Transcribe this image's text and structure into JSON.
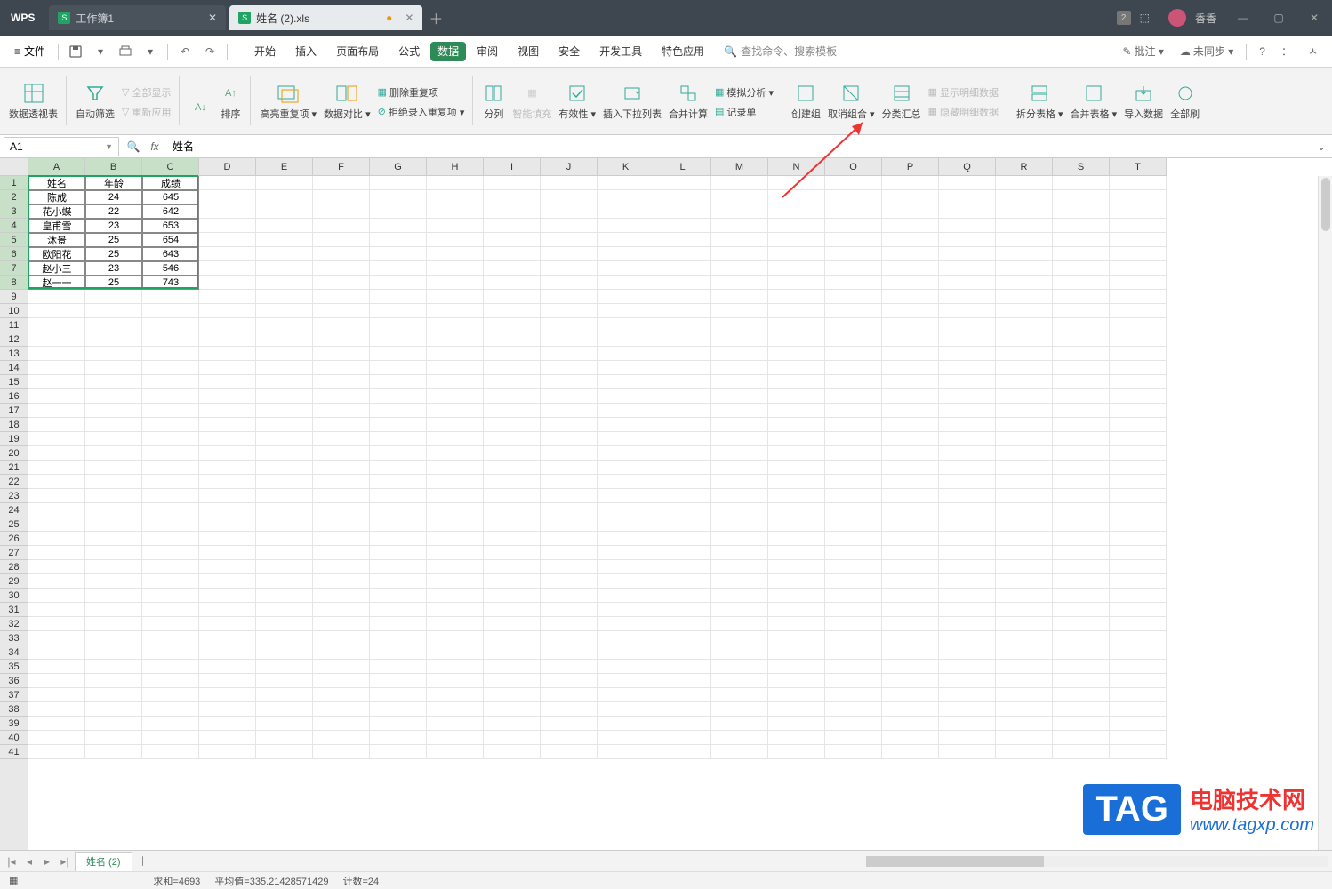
{
  "titlebar": {
    "logo": "WPS",
    "tabs": [
      {
        "label": "工作簿1",
        "active": false
      },
      {
        "label": "姓名 (2).xls",
        "active": true
      }
    ],
    "user": "香香",
    "badge": "2"
  },
  "menubar": {
    "file": "文件",
    "tabs": [
      "开始",
      "插入",
      "页面布局",
      "公式",
      "数据",
      "审阅",
      "视图",
      "安全",
      "开发工具",
      "特色应用"
    ],
    "active_index": 4,
    "search_placeholder": "查找命令、搜索模板",
    "right": {
      "annotate": "批注 ▾",
      "sync": "未同步 ▾"
    }
  },
  "ribbon": {
    "pivot": "数据透视表",
    "autofilter": "自动筛选",
    "showall": "全部显示",
    "reapply": "重新应用",
    "sort": "排序",
    "highlight": "高亮重复项 ▾",
    "compare": "数据对比 ▾",
    "deldup": "删除重复项",
    "reject": "拒绝录入重复项 ▾",
    "split": "分列",
    "flashfill": "智能填充",
    "validation": "有效性 ▾",
    "dropdown": "插入下拉列表",
    "consolidate": "合并计算",
    "whatif": "模拟分析 ▾",
    "recordform": "记录单",
    "group": "创建组",
    "ungroup": "取消组合 ▾",
    "subtotal": "分类汇总",
    "showdetail": "显示明细数据",
    "hidedetail": "隐藏明细数据",
    "splittable": "拆分表格 ▾",
    "mergetable": "合并表格 ▾",
    "import": "导入数据",
    "refresh": "全部刷"
  },
  "formula": {
    "cellref": "A1",
    "content": "姓名",
    "fx": "fx"
  },
  "columns": [
    "A",
    "B",
    "C",
    "D",
    "E",
    "F",
    "G",
    "H",
    "I",
    "J",
    "K",
    "L",
    "M",
    "N",
    "O",
    "P",
    "Q",
    "R",
    "S",
    "T"
  ],
  "colwidth_data": 64,
  "colwidth_other": 64,
  "rowcount_shown": 41,
  "table": {
    "headers": [
      "姓名",
      "年龄",
      "成绩"
    ],
    "rows": [
      [
        "陈成",
        "24",
        "645"
      ],
      [
        "花小蝶",
        "22",
        "642"
      ],
      [
        "皇甫雪",
        "23",
        "653"
      ],
      [
        "沐景",
        "25",
        "654"
      ],
      [
        "欧阳花",
        "25",
        "643"
      ],
      [
        "赵小三",
        "23",
        "546"
      ],
      [
        "赵一一",
        "25",
        "743"
      ]
    ]
  },
  "sheettabs": {
    "active": "姓名 (2)"
  },
  "statusbar": {
    "sum": "求和=4693",
    "avg": "平均值=335.21428571429",
    "count": "计数=24"
  },
  "watermark": {
    "tag": "TAG",
    "cn": "电脑技术网",
    "url": "www.tagxp.com"
  }
}
